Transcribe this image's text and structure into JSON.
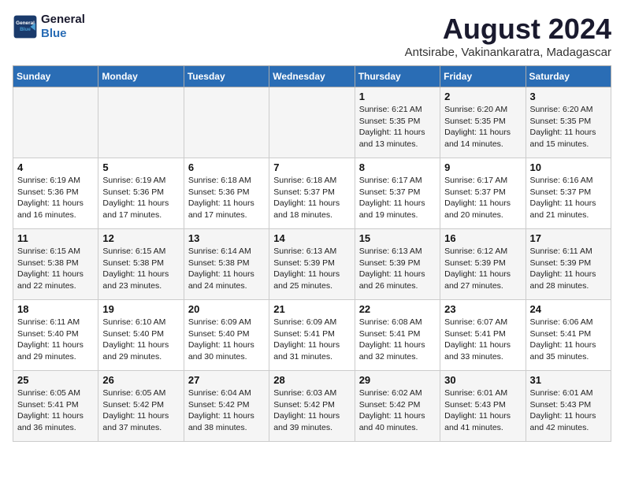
{
  "logo": {
    "line1": "General",
    "line2": "Blue"
  },
  "title": "August 2024",
  "subtitle": "Antsirabe, Vakinankaratra, Madagascar",
  "weekdays": [
    "Sunday",
    "Monday",
    "Tuesday",
    "Wednesday",
    "Thursday",
    "Friday",
    "Saturday"
  ],
  "weeks": [
    [
      {
        "date": "",
        "info": ""
      },
      {
        "date": "",
        "info": ""
      },
      {
        "date": "",
        "info": ""
      },
      {
        "date": "",
        "info": ""
      },
      {
        "date": "1",
        "info": "Sunrise: 6:21 AM\nSunset: 5:35 PM\nDaylight: 11 hours\nand 13 minutes."
      },
      {
        "date": "2",
        "info": "Sunrise: 6:20 AM\nSunset: 5:35 PM\nDaylight: 11 hours\nand 14 minutes."
      },
      {
        "date": "3",
        "info": "Sunrise: 6:20 AM\nSunset: 5:35 PM\nDaylight: 11 hours\nand 15 minutes."
      }
    ],
    [
      {
        "date": "4",
        "info": "Sunrise: 6:19 AM\nSunset: 5:36 PM\nDaylight: 11 hours\nand 16 minutes."
      },
      {
        "date": "5",
        "info": "Sunrise: 6:19 AM\nSunset: 5:36 PM\nDaylight: 11 hours\nand 17 minutes."
      },
      {
        "date": "6",
        "info": "Sunrise: 6:18 AM\nSunset: 5:36 PM\nDaylight: 11 hours\nand 17 minutes."
      },
      {
        "date": "7",
        "info": "Sunrise: 6:18 AM\nSunset: 5:37 PM\nDaylight: 11 hours\nand 18 minutes."
      },
      {
        "date": "8",
        "info": "Sunrise: 6:17 AM\nSunset: 5:37 PM\nDaylight: 11 hours\nand 19 minutes."
      },
      {
        "date": "9",
        "info": "Sunrise: 6:17 AM\nSunset: 5:37 PM\nDaylight: 11 hours\nand 20 minutes."
      },
      {
        "date": "10",
        "info": "Sunrise: 6:16 AM\nSunset: 5:37 PM\nDaylight: 11 hours\nand 21 minutes."
      }
    ],
    [
      {
        "date": "11",
        "info": "Sunrise: 6:15 AM\nSunset: 5:38 PM\nDaylight: 11 hours\nand 22 minutes."
      },
      {
        "date": "12",
        "info": "Sunrise: 6:15 AM\nSunset: 5:38 PM\nDaylight: 11 hours\nand 23 minutes."
      },
      {
        "date": "13",
        "info": "Sunrise: 6:14 AM\nSunset: 5:38 PM\nDaylight: 11 hours\nand 24 minutes."
      },
      {
        "date": "14",
        "info": "Sunrise: 6:13 AM\nSunset: 5:39 PM\nDaylight: 11 hours\nand 25 minutes."
      },
      {
        "date": "15",
        "info": "Sunrise: 6:13 AM\nSunset: 5:39 PM\nDaylight: 11 hours\nand 26 minutes."
      },
      {
        "date": "16",
        "info": "Sunrise: 6:12 AM\nSunset: 5:39 PM\nDaylight: 11 hours\nand 27 minutes."
      },
      {
        "date": "17",
        "info": "Sunrise: 6:11 AM\nSunset: 5:39 PM\nDaylight: 11 hours\nand 28 minutes."
      }
    ],
    [
      {
        "date": "18",
        "info": "Sunrise: 6:11 AM\nSunset: 5:40 PM\nDaylight: 11 hours\nand 29 minutes."
      },
      {
        "date": "19",
        "info": "Sunrise: 6:10 AM\nSunset: 5:40 PM\nDaylight: 11 hours\nand 29 minutes."
      },
      {
        "date": "20",
        "info": "Sunrise: 6:09 AM\nSunset: 5:40 PM\nDaylight: 11 hours\nand 30 minutes."
      },
      {
        "date": "21",
        "info": "Sunrise: 6:09 AM\nSunset: 5:41 PM\nDaylight: 11 hours\nand 31 minutes."
      },
      {
        "date": "22",
        "info": "Sunrise: 6:08 AM\nSunset: 5:41 PM\nDaylight: 11 hours\nand 32 minutes."
      },
      {
        "date": "23",
        "info": "Sunrise: 6:07 AM\nSunset: 5:41 PM\nDaylight: 11 hours\nand 33 minutes."
      },
      {
        "date": "24",
        "info": "Sunrise: 6:06 AM\nSunset: 5:41 PM\nDaylight: 11 hours\nand 35 minutes."
      }
    ],
    [
      {
        "date": "25",
        "info": "Sunrise: 6:05 AM\nSunset: 5:41 PM\nDaylight: 11 hours\nand 36 minutes."
      },
      {
        "date": "26",
        "info": "Sunrise: 6:05 AM\nSunset: 5:42 PM\nDaylight: 11 hours\nand 37 minutes."
      },
      {
        "date": "27",
        "info": "Sunrise: 6:04 AM\nSunset: 5:42 PM\nDaylight: 11 hours\nand 38 minutes."
      },
      {
        "date": "28",
        "info": "Sunrise: 6:03 AM\nSunset: 5:42 PM\nDaylight: 11 hours\nand 39 minutes."
      },
      {
        "date": "29",
        "info": "Sunrise: 6:02 AM\nSunset: 5:42 PM\nDaylight: 11 hours\nand 40 minutes."
      },
      {
        "date": "30",
        "info": "Sunrise: 6:01 AM\nSunset: 5:43 PM\nDaylight: 11 hours\nand 41 minutes."
      },
      {
        "date": "31",
        "info": "Sunrise: 6:01 AM\nSunset: 5:43 PM\nDaylight: 11 hours\nand 42 minutes."
      }
    ]
  ]
}
